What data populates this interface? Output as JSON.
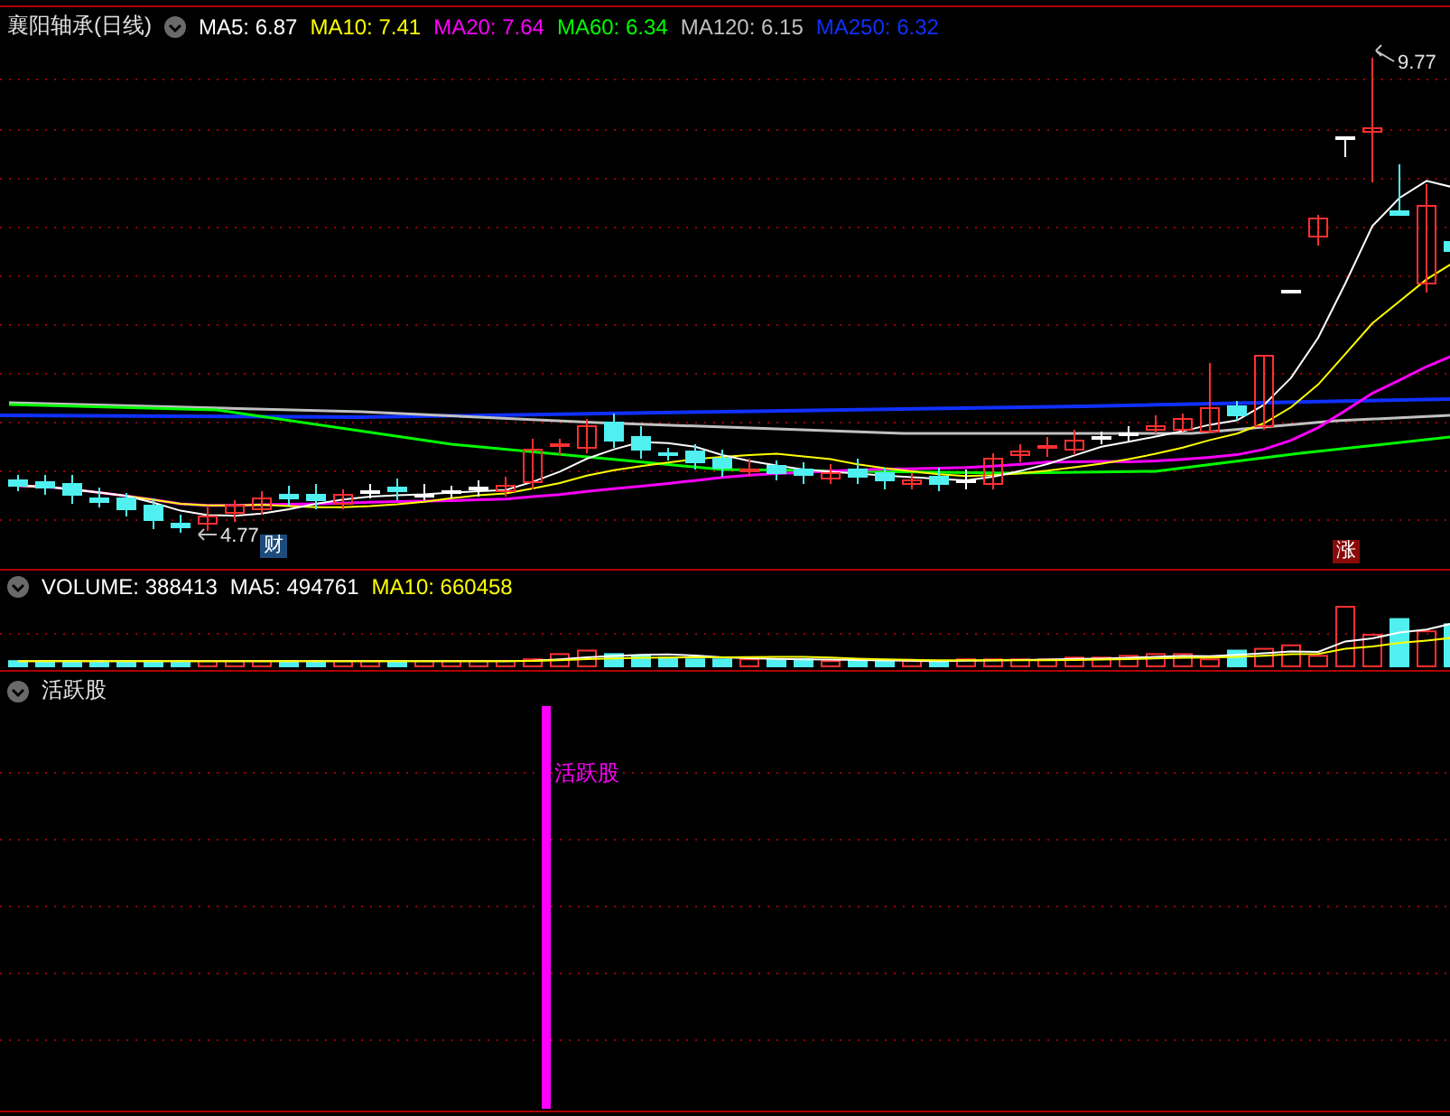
{
  "chart": {
    "title": "襄阳轴承(日线)",
    "indicators": [
      {
        "label": "MA5: 6.87",
        "color": "#ffffff"
      },
      {
        "label": "MA10: 7.41",
        "color": "#ffff00"
      },
      {
        "label": "MA20: 7.64",
        "color": "#ff00ff"
      },
      {
        "label": "MA60: 6.34",
        "color": "#00ff00"
      },
      {
        "label": "MA120: 6.15",
        "color": "#c0c0c0"
      },
      {
        "label": "MA250: 6.32",
        "color": "#1030ff"
      }
    ],
    "high_label": "9.77",
    "low_label": "4.77",
    "badges": [
      {
        "text": "财",
        "kind": "finance"
      },
      {
        "text": "涨",
        "kind": "rise"
      }
    ]
  },
  "volume": {
    "indicators": [
      {
        "label": "VOLUME: 388413",
        "color": "#ffffff"
      },
      {
        "label": "MA5: 494761",
        "color": "#ffffff"
      },
      {
        "label": "MA10: 660458",
        "color": "#ffff00"
      }
    ]
  },
  "indicator_panel": {
    "title": "活跃股",
    "signal_label": "活跃股"
  }
}
